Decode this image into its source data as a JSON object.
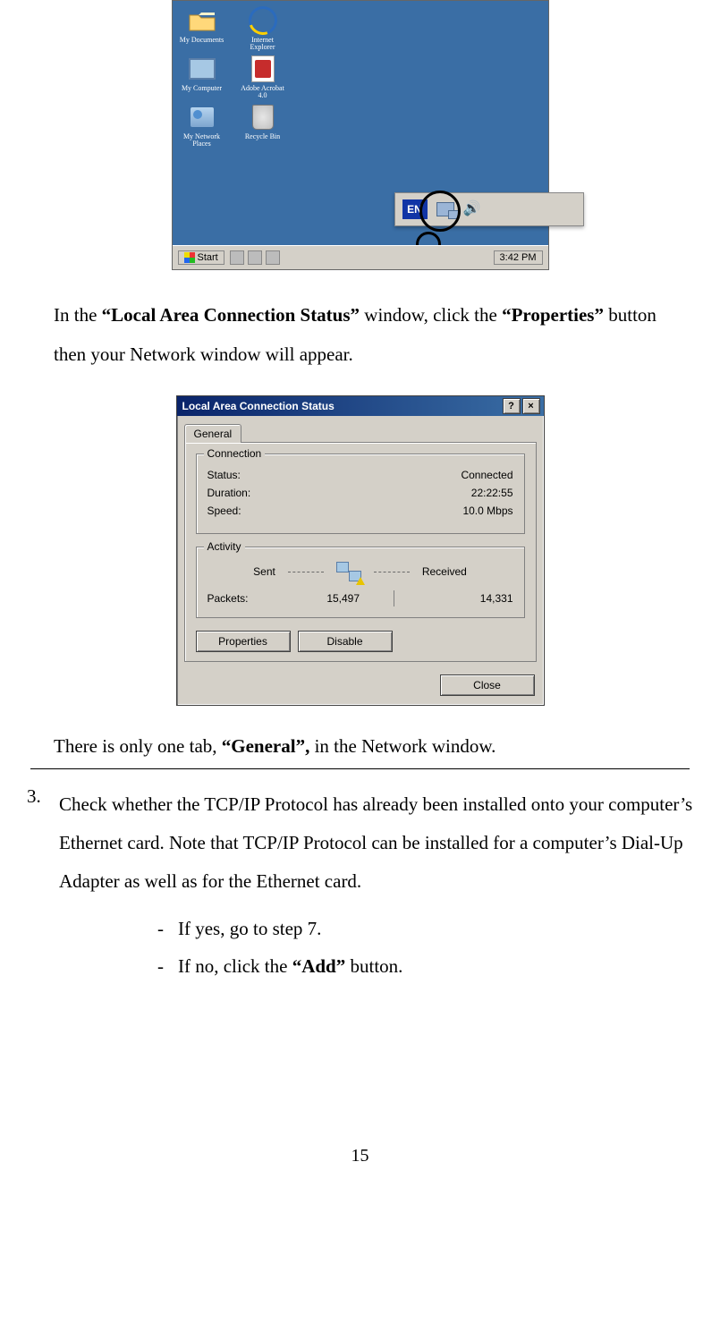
{
  "desktop": {
    "icons": [
      {
        "label": "My Documents",
        "kind": "folder"
      },
      {
        "label": "Internet Explorer",
        "kind": "ie"
      },
      {
        "label": "My Computer",
        "kind": "monitor"
      },
      {
        "label": "Adobe Acrobat 4.0",
        "kind": "acrobat"
      },
      {
        "label": "My Network Places",
        "kind": "netplaces"
      },
      {
        "label": "Recycle Bin",
        "kind": "recycle"
      }
    ],
    "tray": {
      "lang": "EN"
    },
    "taskbar": {
      "start": "Start",
      "time": "3:42 PM"
    }
  },
  "para1_parts": {
    "a": "In the ",
    "b": "“Local Area Connection Status”",
    "c": " window, click the ",
    "d": "“Properties”",
    "e": " button then your Network window will appear."
  },
  "lac": {
    "title": "Local Area Connection Status",
    "help_glyph": "?",
    "close_glyph": "×",
    "tab": "General",
    "group_connection": "Connection",
    "status_label": "Status:",
    "status_value": "Connected",
    "duration_label": "Duration:",
    "duration_value": "22:22:55",
    "speed_label": "Speed:",
    "speed_value": "10.0 Mbps",
    "group_activity": "Activity",
    "sent_label": "Sent",
    "received_label": "Received",
    "packets_label": "Packets:",
    "packets_sent": "15,497",
    "packets_received": "14,331",
    "btn_properties": "Properties",
    "btn_disable": "Disable",
    "btn_close": "Close"
  },
  "para2_parts": {
    "a": "There is only one tab, ",
    "b": "“General”,",
    "c": " in the Network window."
  },
  "step3": {
    "number": "3.",
    "text": "Check whether the TCP/IP Protocol has already been installed onto your computer’s Ethernet card. Note that TCP/IP Protocol can be installed for a computer’s Dial-Up Adapter as well as for the Ethernet card.",
    "bullets": [
      {
        "dash": "-",
        "parts": {
          "a": "If yes, go to step 7.",
          "b": "",
          "c": ""
        }
      },
      {
        "dash": "-",
        "parts": {
          "a": "If no, click the ",
          "b": "“Add”",
          "c": " button."
        }
      }
    ]
  },
  "page_number": "15"
}
